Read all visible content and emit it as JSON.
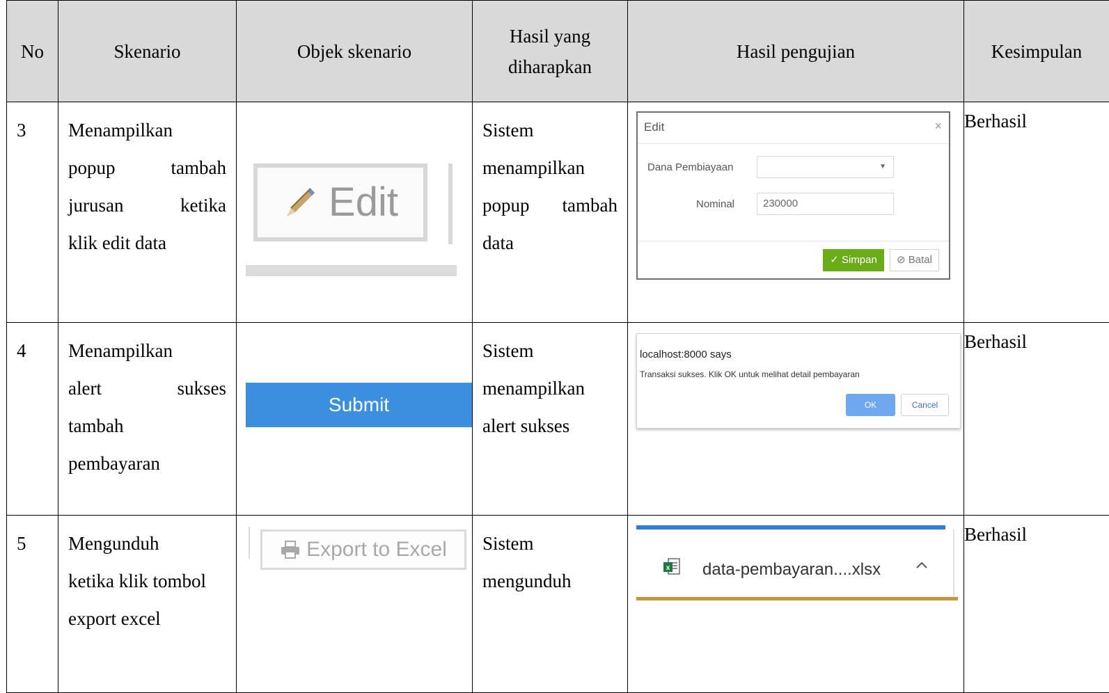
{
  "table": {
    "headers": {
      "no": "No",
      "skenario": "Skenario",
      "objek": "Objek skenario",
      "hasil_harap_1": "Hasil yang",
      "hasil_harap_2": "diharapkan",
      "hasil_uji": "Hasil pengujian",
      "kesimpulan": "Kesimpulan"
    },
    "rows": [
      {
        "no": "3",
        "skenario": [
          "Menampilkan",
          "popup tambah",
          "jurusan ketika",
          "klik edit data"
        ],
        "harapan": [
          "Sistem",
          "menampilkan",
          "popup tambah",
          "data"
        ],
        "kesimpulan": "Berhasil"
      },
      {
        "no": "4",
        "skenario": [
          "Menampilkan",
          "alert sukses",
          "tambah",
          "pembayaran"
        ],
        "harapan": [
          "Sistem",
          "menampilkan",
          "alert sukses"
        ],
        "kesimpulan": "Berhasil"
      },
      {
        "no": "5",
        "skenario": [
          "Mengunduh",
          "ketika klik tombol",
          "export excel"
        ],
        "harapan": [
          "Sistem",
          "mengunduh"
        ],
        "kesimpulan": "Berhasil"
      }
    ]
  },
  "objects": {
    "edit_label": "Edit",
    "submit_label": "Submit",
    "export_label": "Export to Excel"
  },
  "edit_modal": {
    "title": "Edit",
    "close": "×",
    "dana_label": "Dana Pembiayaan",
    "dana_value": "",
    "nominal_label": "Nominal",
    "nominal_value": "230000",
    "save_label": "Simpan",
    "cancel_label": "Batal"
  },
  "alert": {
    "origin": "localhost:8000 says",
    "message": "Transaksi sukses. Klik OK untuk melihat detail pembayaran",
    "ok_label": "OK",
    "cancel_label": "Cancel"
  },
  "download": {
    "filename": "data-pembayaran....xlsx",
    "progress_accent": "#2f7de0"
  },
  "colors": {
    "header_bg": "#d9d9d9",
    "submit_bg": "#3b8fdc",
    "save_bg": "#6aab1a",
    "ok_bg": "#6fa8ee"
  }
}
